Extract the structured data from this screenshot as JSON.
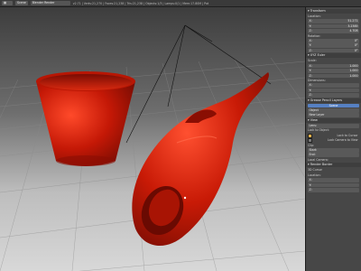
{
  "toolbar": {
    "scene": "Scene",
    "engine": "Blender Render",
    "info": "v2.71 | Verts:21,270 | Faces:21,238 | Tris:21,238 | Objects:1/3 | Lamps:0/1 | Mem:17.80M | Pot"
  },
  "panel": {
    "sections": [
      {
        "title": "Transform",
        "rows": [
          {
            "label": "Location:",
            "plain": true
          },
          {
            "label": "X:",
            "value": "51.271"
          },
          {
            "label": "Y:",
            "value": "3.2385"
          },
          {
            "label": "Z:",
            "value": "4.708"
          },
          {
            "label": "Rotation:",
            "plain": true
          },
          {
            "label": "X:",
            "value": "0°"
          },
          {
            "label": "Y:",
            "value": "0°"
          },
          {
            "label": "Z:",
            "value": "0°"
          }
        ]
      },
      {
        "title": "XYZ Euler",
        "rows": [
          {
            "label": "Scale:",
            "plain": true
          },
          {
            "label": "X:",
            "value": "1.000"
          },
          {
            "label": "Y:",
            "value": "1.000"
          },
          {
            "label": "Z:",
            "value": "1.000"
          },
          {
            "label": "Dimensions:",
            "plain": true
          },
          {
            "label": "X:",
            "value": ""
          },
          {
            "label": "Y:",
            "value": ""
          },
          {
            "label": "Z:",
            "value": ""
          }
        ]
      },
      {
        "title": "Grease Pencil Layers",
        "rows": [
          {
            "label": "Scene",
            "blue": true
          },
          {
            "label": "Object",
            "value": ""
          },
          {
            "label": "New Layer",
            "value": ""
          }
        ]
      },
      {
        "title": "View",
        "rows": [
          {
            "label": "Lens:",
            "value": ""
          },
          {
            "label": "Lock to Object:",
            "plain": true
          },
          {
            "label": "Lock to Cursor",
            "check": true
          },
          {
            "label": "Lock Camera to View",
            "check": false
          },
          {
            "label": "Clip:",
            "plain": true
          },
          {
            "label": "Start:",
            "value": ""
          },
          {
            "label": "End:",
            "value": ""
          },
          {
            "label": "Local Camera:",
            "plain": true
          }
        ]
      },
      {
        "title": "Render Border",
        "rows": [
          {
            "label": "3D Cursor",
            "plain": true
          },
          {
            "label": "Location:",
            "plain": true
          },
          {
            "label": "X:",
            "value": ""
          },
          {
            "label": "Y:",
            "value": ""
          },
          {
            "label": "Z:",
            "value": ""
          }
        ]
      }
    ]
  },
  "colors": {
    "object": "#c21a06",
    "object_dark": "#6e0a02",
    "object_light": "#ff5a3a"
  }
}
